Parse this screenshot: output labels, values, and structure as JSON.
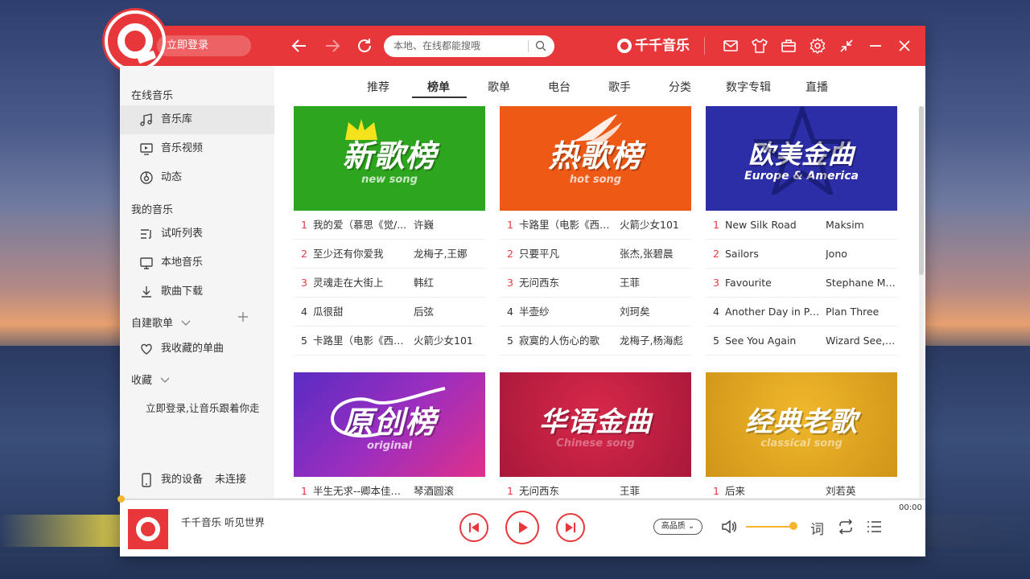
{
  "header": {
    "login_label": "立即登录",
    "search_placeholder": "本地、在线都能搜哦",
    "brand": "千千音乐"
  },
  "sidebar": {
    "sections": {
      "online": "在线音乐",
      "my_music": "我的音乐",
      "playlists": "自建歌单",
      "favorites": "收藏"
    },
    "items": {
      "music_library": "音乐库",
      "music_video": "音乐视频",
      "activity": "动态",
      "trial_list": "试听列表",
      "local_music": "本地音乐",
      "downloads": "歌曲下载",
      "fav_songs": "我收藏的单曲",
      "login_hint": "立即登录,让音乐跟着你走",
      "my_device": "我的设备",
      "device_status": "未连接"
    }
  },
  "tabs": [
    "推荐",
    "榜单",
    "歌单",
    "电台",
    "歌手",
    "分类",
    "数字专辑",
    "直播"
  ],
  "active_tab": "榜单",
  "charts": [
    {
      "title": "新歌榜",
      "subtitle": "new song",
      "bg": "#2ea51f",
      "rows": [
        {
          "n": "1",
          "song": "我的爱（慕思《觉/...",
          "artist": "许巍"
        },
        {
          "n": "2",
          "song": "至少还有你爱我",
          "artist": "龙梅子,王娜"
        },
        {
          "n": "3",
          "song": "灵魂走在大街上",
          "artist": "韩红"
        },
        {
          "n": "4",
          "song": "瓜很甜",
          "artist": "后弦"
        },
        {
          "n": "5",
          "song": "卡路里（电影《西虹...",
          "artist": "火箭少女101"
        }
      ]
    },
    {
      "title": "热歌榜",
      "subtitle": "hot song",
      "bg": "#ee5a16",
      "rows": [
        {
          "n": "1",
          "song": "卡路里（电影《西虹...",
          "artist": "火箭少女101"
        },
        {
          "n": "2",
          "song": "只要平凡",
          "artist": "张杰,张碧晨"
        },
        {
          "n": "3",
          "song": "无问西东",
          "artist": "王菲"
        },
        {
          "n": "4",
          "song": "半壶纱",
          "artist": "刘珂矣"
        },
        {
          "n": "5",
          "song": "寂寞的人伤心的歌",
          "artist": "龙梅子,杨海彪"
        }
      ]
    },
    {
      "title": "欧美金曲",
      "subtitle": "Europe & America",
      "bg": "#2c2ea8",
      "rows": [
        {
          "n": "1",
          "song": "New Silk Road",
          "artist": "Maksim"
        },
        {
          "n": "2",
          "song": "Sailors",
          "artist": "Jono"
        },
        {
          "n": "3",
          "song": "Favourite",
          "artist": "Stephane Mo..."
        },
        {
          "n": "4",
          "song": "Another Day in Par...",
          "artist": "Plan Three"
        },
        {
          "n": "5",
          "song": "See You Again",
          "artist": "Wizard See,C..."
        }
      ]
    },
    {
      "title": "原创榜",
      "subtitle": "original",
      "bg": "#8a2ec2",
      "rows": [
        {
          "n": "1",
          "song": "半生无求--卿本佳人...",
          "artist": "琴酒圆滚"
        }
      ]
    },
    {
      "title": "华语金曲",
      "subtitle": "Chinese song",
      "bg": "#c8203e",
      "rows": [
        {
          "n": "1",
          "song": "无问西东",
          "artist": "王菲"
        }
      ]
    },
    {
      "title": "经典老歌",
      "subtitle": "classical song",
      "bg": "#e0a41c",
      "rows": [
        {
          "n": "1",
          "song": "后来",
          "artist": "刘若英"
        }
      ]
    }
  ],
  "player": {
    "now_playing": "千千音乐 听见世界",
    "time": "00:00",
    "quality": "高品质",
    "lyric_label": "词",
    "volume": 0.9,
    "progress": 0
  },
  "colors": {
    "accent": "#e8373a",
    "gold": "#f7b52b"
  }
}
